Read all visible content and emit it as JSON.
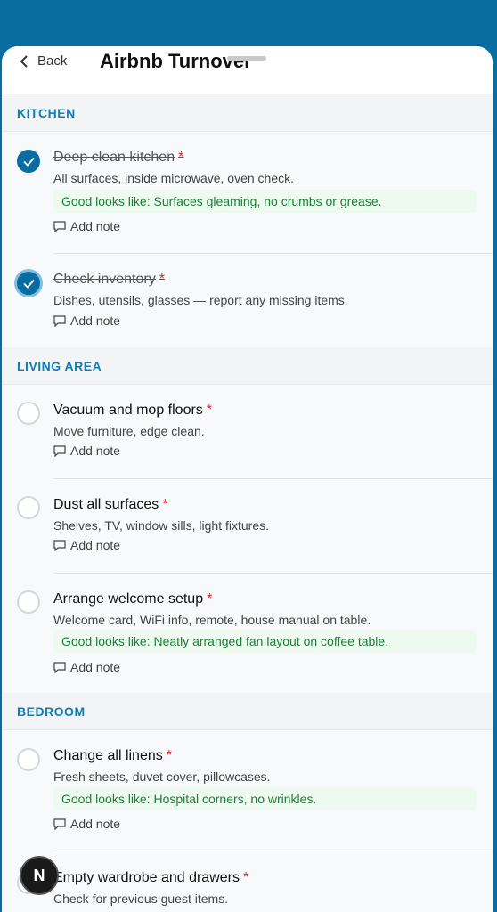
{
  "header": {
    "back_label": "Back",
    "title": "Airbnb Turnover"
  },
  "sections": [
    {
      "label": "KITCHEN",
      "items": [
        {
          "title": "Deep clean kitchen",
          "required": "*",
          "description": "All surfaces, inside microwave, oven check.",
          "good": "Good looks like: Surfaces gleaming, no crumbs or grease.",
          "note": "Add note",
          "checked": true
        },
        {
          "title": "Check inventory",
          "required": "*",
          "description": "Dishes, utensils, glasses — report any missing items.",
          "note": "Add note",
          "checked": true
        }
      ]
    },
    {
      "label": "LIVING AREA",
      "items": [
        {
          "title": "Vacuum and mop floors",
          "required": "*",
          "description": "Move furniture, edge clean.",
          "note": "Add note",
          "checked": false
        },
        {
          "title": "Dust all surfaces",
          "required": "*",
          "description": "Shelves, TV, window sills, light fixtures.",
          "note": "Add note",
          "checked": false
        },
        {
          "title": "Arrange welcome setup",
          "required": "*",
          "description": "Welcome card, WiFi info, remote, house manual on table.",
          "good": "Good looks like: Neatly arranged fan layout on coffee table.",
          "note": "Add note",
          "checked": false
        }
      ]
    },
    {
      "label": "BEDROOM",
      "items": [
        {
          "title": "Change all linens",
          "required": "*",
          "description": "Fresh sheets, duvet cover, pillowcases.",
          "good": "Good looks like: Hospital corners, no wrinkles.",
          "note": "Add note",
          "checked": false
        },
        {
          "title": "Empty wardrobe and drawers",
          "required": "*",
          "description": "Check for previous guest items.",
          "checked": false
        }
      ]
    }
  ],
  "fab": {
    "label": "N"
  },
  "colors": {
    "accent": "#0a6da1",
    "section_text": "#0b7fb8",
    "required": "#d42a2a",
    "good_bg": "#eefaf0",
    "good_text": "#1a7f37"
  }
}
